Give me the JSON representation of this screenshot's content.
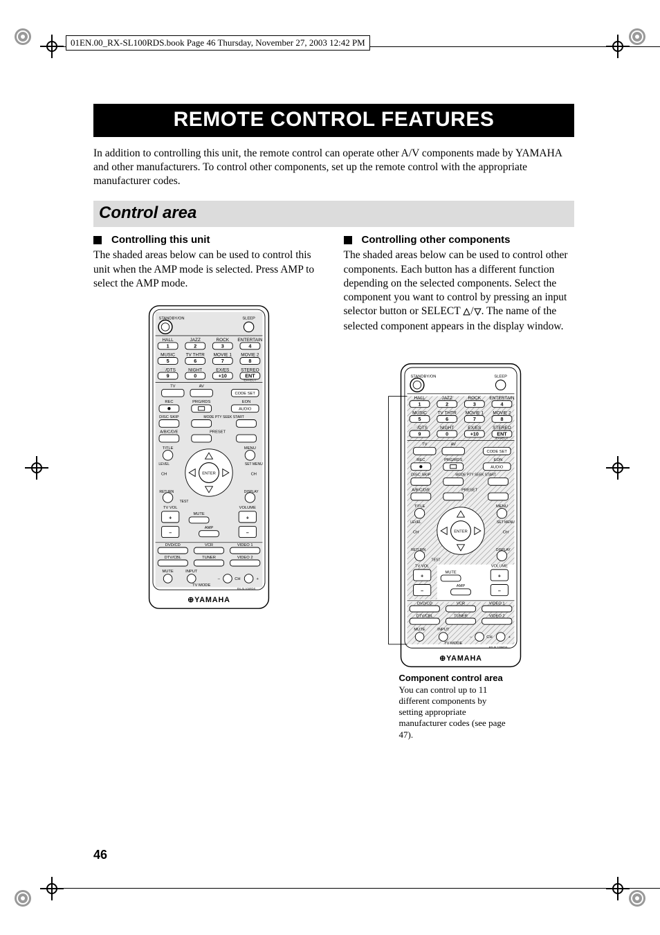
{
  "meta_line": "01EN.00_RX-SL100RDS.book  Page 46  Thursday, November 27, 2003  12:42 PM",
  "title": "REMOTE CONTROL FEATURES",
  "intro": "In addition to controlling this unit, the remote control can operate other A/V components made by YAMAHA and other manufacturers. To control other components, set up the remote control with the appropriate manufacturer codes.",
  "section_heading": "Control area",
  "left": {
    "heading": "Controlling this unit",
    "body": "The shaded areas below can be used to control this unit when the AMP mode is selected. Press AMP to select the AMP mode."
  },
  "right": {
    "heading": "Controlling other components",
    "body_a": "The shaded areas below can be used to control other components. Each button has a different function depending on the selected components. Select the component you want to control by pressing an input selector button or SELECT ",
    "body_b": ". The name of the selected component appears in the display window."
  },
  "annotation": {
    "title": "Component control area",
    "body": "You can control up to 11 different components by setting appropriate manufacturer codes (see page 47)."
  },
  "page_number": "46",
  "remote": {
    "brand": "YAMAHA",
    "model": "RX-SL100RDS",
    "top": {
      "standby": "STANDBY/ON",
      "sleep": "SLEEP"
    },
    "row1_labels": [
      "HALL",
      "JAZZ",
      "ROCK",
      "ENTERTAIN"
    ],
    "row1_nums": [
      "1",
      "2",
      "3",
      "4"
    ],
    "row2_labels": [
      "MUSIC",
      "TV THTR",
      "MOVIE 1",
      "MOVIE 2"
    ],
    "row2_nums": [
      "5",
      "6",
      "7",
      "8"
    ],
    "row3_labels": [
      "⬜/DTS",
      "NIGHT",
      "EX/ES",
      "STEREO"
    ],
    "row3_nums": [
      "9",
      "0",
      "+10",
      "ENT"
    ],
    "row3_right": "EFFECT",
    "tv_av_row": {
      "tv": "TV",
      "av": "AV",
      "codeset": "CODE SET"
    },
    "rec_row": {
      "rec": "REC",
      "prgrds": "PRG/RDS",
      "eon": "EON",
      "audio": "AUDIO"
    },
    "disc_row": {
      "disc": "DISC SKIP",
      "mode": "MODE PTY SEEK START"
    },
    "abcde": "A/B/C/D/E",
    "preset": "PRESET",
    "nav": {
      "title": "TITLE",
      "menu": "MENU",
      "level": "LEVEL",
      "setmenu": "SET MENU",
      "ch": "CH",
      "return": "RETURN",
      "display": "DISPLAY",
      "test": "TEST",
      "enter": "ENTER",
      "plus": "+",
      "minus": "–"
    },
    "vol": {
      "tvvol": "TV VOL",
      "mute": "MUTE",
      "amp": "AMP",
      "volume": "VOLUME"
    },
    "inputs_row1": [
      "DVD/CD",
      "VCR",
      "VIDEO 1"
    ],
    "inputs_row2": [
      "DTV/CBL",
      "TUNER",
      "VIDEO 2"
    ],
    "tvmode_row": {
      "mute": "MUTE",
      "input": "INPUT",
      "tvmode": "TV MODE",
      "chm": "–",
      "ch": "CH",
      "chp": "+"
    }
  }
}
